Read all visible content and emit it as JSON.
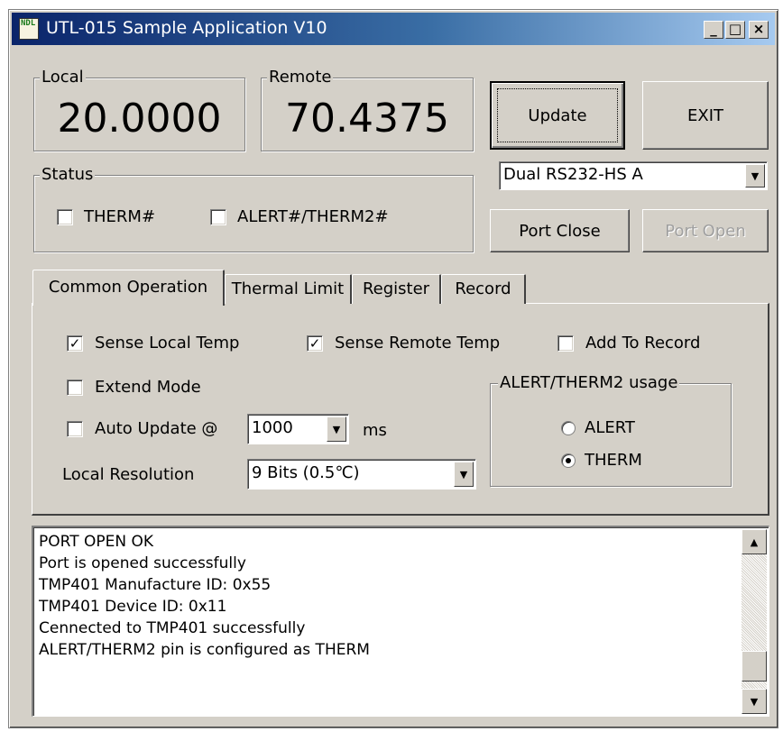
{
  "window": {
    "title": "UTL-015 Sample Application V10",
    "icon_text": "NDL",
    "controls": {
      "minimize": "_",
      "maximize": "□",
      "close": "×"
    }
  },
  "readouts": {
    "local": {
      "label": "Local",
      "value": "20.0000"
    },
    "remote": {
      "label": "Remote",
      "value": "70.4375"
    }
  },
  "buttons": {
    "update": "Update",
    "exit": "EXIT",
    "port_close": "Port Close",
    "port_open": "Port Open"
  },
  "port_select": {
    "value": "Dual RS232-HS A"
  },
  "status": {
    "label": "Status",
    "therm": {
      "label": "THERM#",
      "checked": false
    },
    "alert": {
      "label": "ALERT#/THERM2#",
      "checked": false
    }
  },
  "tabs": [
    {
      "label": "Common Operation",
      "active": true
    },
    {
      "label": "Thermal Limit",
      "active": false
    },
    {
      "label": "Register",
      "active": false
    },
    {
      "label": "Record",
      "active": false
    }
  ],
  "common_operation": {
    "sense_local": {
      "label": "Sense Local Temp",
      "checked": true
    },
    "sense_remote": {
      "label": "Sense Remote Temp",
      "checked": true
    },
    "add_to_record": {
      "label": "Add To Record",
      "checked": false
    },
    "extend_mode": {
      "label": "Extend Mode",
      "checked": false
    },
    "auto_update": {
      "label": "Auto Update @",
      "checked": false,
      "interval": "1000",
      "unit": "ms"
    },
    "local_resolution": {
      "label": "Local Resolution",
      "value": "9 Bits (0.5℃)"
    },
    "alert_usage": {
      "label": "ALERT/THERM2 usage",
      "options": [
        {
          "label": "ALERT",
          "selected": false
        },
        {
          "label": "THERM",
          "selected": true
        }
      ]
    }
  },
  "log": {
    "lines": [
      "PORT OPEN OK",
      "Port is opened successfully",
      "TMP401 Manufacture ID: 0x55",
      "TMP401 Device ID: 0x11",
      "Cennected to TMP401 successfully",
      "ALERT/THERM2 pin is configured as THERM"
    ]
  }
}
